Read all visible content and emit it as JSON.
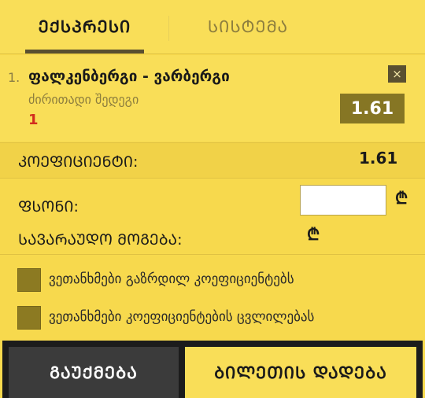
{
  "tabs": {
    "express": "ᲔᲥᲡᲞᲠᲔᲡᲘ",
    "system": "ᲡᲘᲡᲢᲔᲛᲐ"
  },
  "bet": {
    "index": "1.",
    "title": "ფალკენბერგი - ვარბერგი",
    "market": "ძირითადი შედეგი",
    "outcome": "1",
    "odds": "1.61",
    "remove_symbol": "×"
  },
  "summary": {
    "coefficient_label": "ᲙᲝᲔᲤᲘᲪᲘᲔᲜᲢᲘ:",
    "coefficient_value": "1.61",
    "stake_label": "ᲤᲡᲝᲜᲘ:",
    "stake_value": "",
    "currency_symbol": "₾",
    "possible_win_label": "ᲡᲐᲕᲐᲠᲐᲣᲓᲝ ᲛᲝᲒᲔᲑᲐ:"
  },
  "options": {
    "accept_increased_odds": "ვეთანხმები გაზრდილ კოეფიციენტებს",
    "accept_odds_change": "ვეთანხმები კოეფიციენტების ცვლილებას"
  },
  "actions": {
    "cancel": "ᲒᲐᲣᲥᲛᲔᲑᲐ",
    "place_bet": "ᲑᲘᲚᲔᲗᲘᲡ ᲓᲐᲓᲔᲑᲐ"
  },
  "colors": {
    "background": "#f7d94d",
    "odds_box": "#867624",
    "outcome_red": "#d22d1e",
    "footer": "#1c1c1c"
  }
}
